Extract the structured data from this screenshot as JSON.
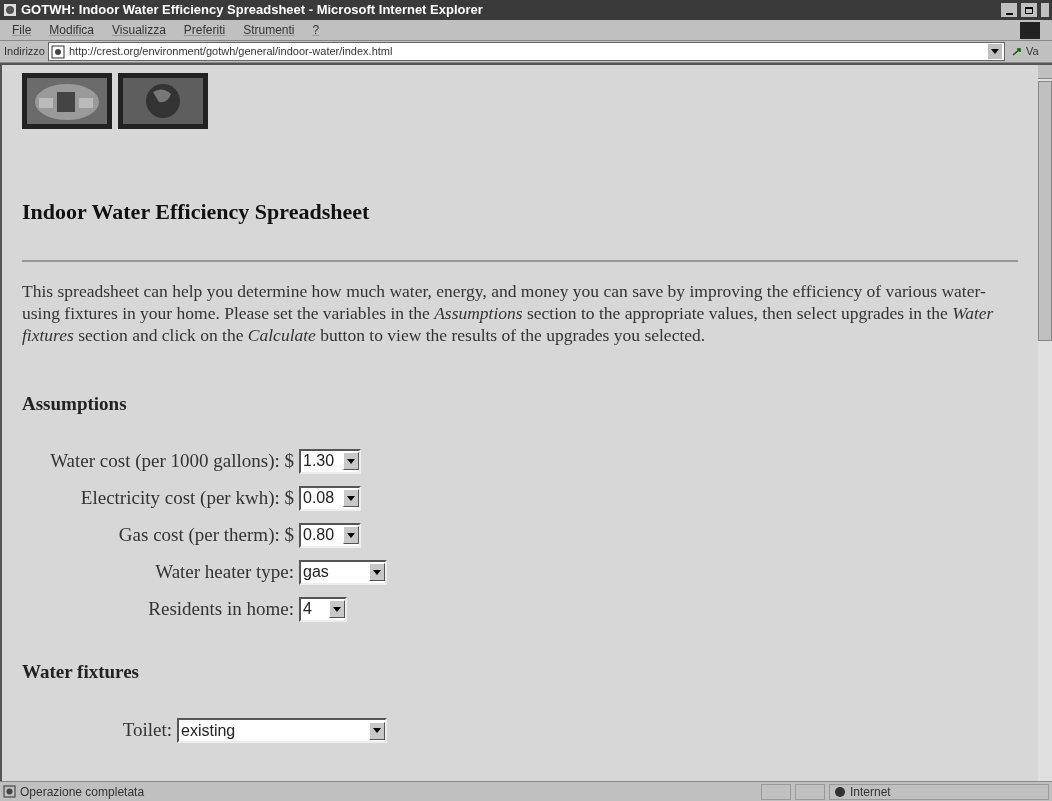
{
  "window": {
    "title": "GOTWH: Indoor Water Efficiency Spreadsheet - Microsoft Internet Explorer"
  },
  "menu": [
    "File",
    "Modifica",
    "Visualizza",
    "Preferiti",
    "Strumenti",
    "?"
  ],
  "address_bar": {
    "label": "Indirizzo",
    "value": "http://crest.org/environment/gotwh/general/indoor-water/index.html",
    "go_button": "Va"
  },
  "page": {
    "heading": "Indoor Water Efficiency Spreadsheet",
    "intro": "This spreadsheet can help you determine how much water, energy, and money you can save by improving the efficiency of various water-using fixtures in your home. Please set the variables in the *Assumptions* section to the appropriate values, then select upgrades in the *Water fixtures* section and click on the *Calculate* button to view the results of the upgrades you selected.",
    "assumptions": {
      "heading": "Assumptions",
      "fields": [
        {
          "label": "Water cost (per 1000 gallons): $",
          "value": "1.30"
        },
        {
          "label": "Electricity cost (per kwh): $",
          "value": "0.08"
        },
        {
          "label": "Gas cost (per therm): $",
          "value": "0.80"
        },
        {
          "label": "Water heater type:",
          "value": "gas"
        },
        {
          "label": "Residents in home:",
          "value": "4"
        }
      ]
    },
    "fixtures": {
      "heading": "Water fixtures",
      "fields": [
        {
          "label": "Toilet:",
          "value": "existing"
        }
      ]
    }
  },
  "status_bar": {
    "text": "Operazione completata",
    "zone": "Internet"
  }
}
